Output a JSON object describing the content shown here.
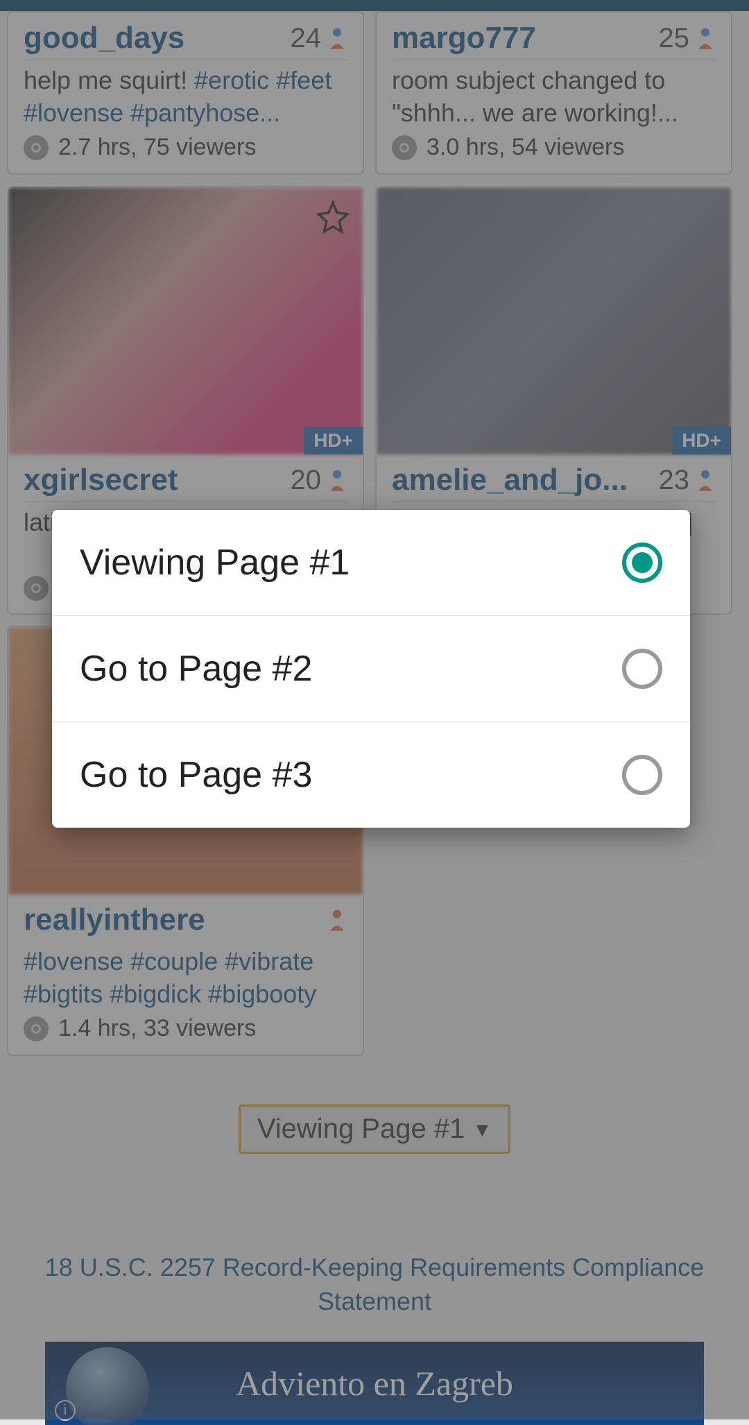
{
  "cards": [
    {
      "username": "good_days",
      "age": "24",
      "hd": "",
      "desc_plain": "help me squirt! ",
      "desc_tags": "#erotic #feet #lovense #pantyhose...",
      "meta": "2.7 hrs, 75 viewers"
    },
    {
      "username": "margo777",
      "age": "25",
      "hd": "",
      "desc_plain": "room subject changed to \"shhh... we are working!...",
      "desc_tags": "",
      "meta": "3.0 hrs, 54 viewers"
    },
    {
      "username": "xgirlsecret",
      "age": "20",
      "hd": "HD+",
      "desc_plain": "lati",
      "desc_tags": "",
      "meta": ""
    },
    {
      "username": "amelie_and_jo...",
      "age": "23",
      "hd": "HD+",
      "desc_plain": "",
      "desc_tags": "",
      "meta": ""
    },
    {
      "username": "reallyinthere",
      "age": "",
      "hd": "",
      "desc_plain": "",
      "desc_tags": "#lovense #couple #vibrate #bigtits #bigdick #bigbooty",
      "meta": "1.4 hrs, 33 viewers"
    }
  ],
  "pager_label": "Viewing Page #1",
  "legal": "18 U.S.C. 2257 Record-Keeping Requirements Compliance Statement",
  "ad_text": "Adviento en Zagreb",
  "dialog": {
    "options": [
      {
        "label": "Viewing Page #1",
        "selected": true
      },
      {
        "label": "Go to Page #2",
        "selected": false
      },
      {
        "label": "Go to Page #3",
        "selected": false
      }
    ]
  }
}
